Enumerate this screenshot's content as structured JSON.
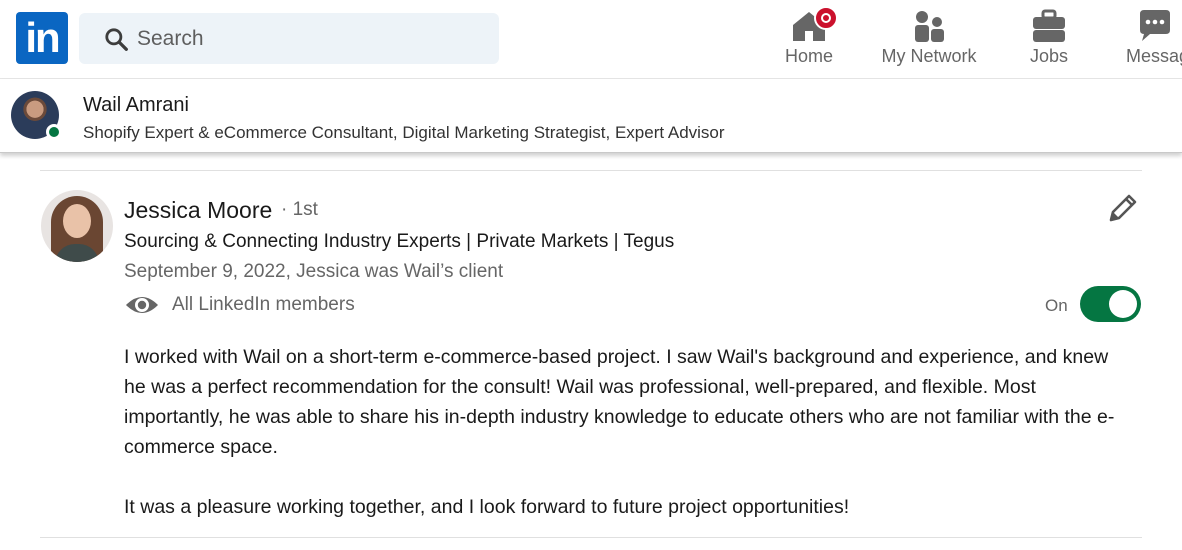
{
  "nav": {
    "logo_text": "in",
    "search": {
      "placeholder": "Search"
    },
    "items": [
      {
        "label": "Home",
        "icon": "home-icon"
      },
      {
        "label": "My Network",
        "icon": "my-network-icon"
      },
      {
        "label": "Jobs",
        "icon": "jobs-icon"
      },
      {
        "label": "Messag",
        "icon": "messaging-icon"
      }
    ],
    "notification_color": "#cb112d"
  },
  "profile_bar": {
    "name": "Wail Amrani",
    "headline": "Shopify Expert & eCommerce Consultant, Digital Marketing Strategist, Expert Advisor",
    "online_color": "#057642"
  },
  "recommendation": {
    "name": "Jessica Moore",
    "degree": "· 1st",
    "headline": "Sourcing & Connecting Industry Experts | Private Markets | Tegus",
    "meta": "September 9, 2022, Jessica was Wail’s client",
    "visibility": "All LinkedIn members",
    "toggle_label": "On",
    "toggle_on": true,
    "toggle_color": "#057642",
    "paragraphs": [
      "I worked with Wail on a short-term e-commerce-based project. I saw Wail's background and experience, and knew he was a perfect recommendation for the consult! Wail was professional, well-prepared, and flexible. Most importantly, he was able to share his in-depth industry knowledge to educate others who are not familiar with the e-commerce space.",
      "It was a pleasure working together, and I look forward to future project opportunities!"
    ]
  },
  "colors": {
    "brand": "#0a66c2"
  }
}
